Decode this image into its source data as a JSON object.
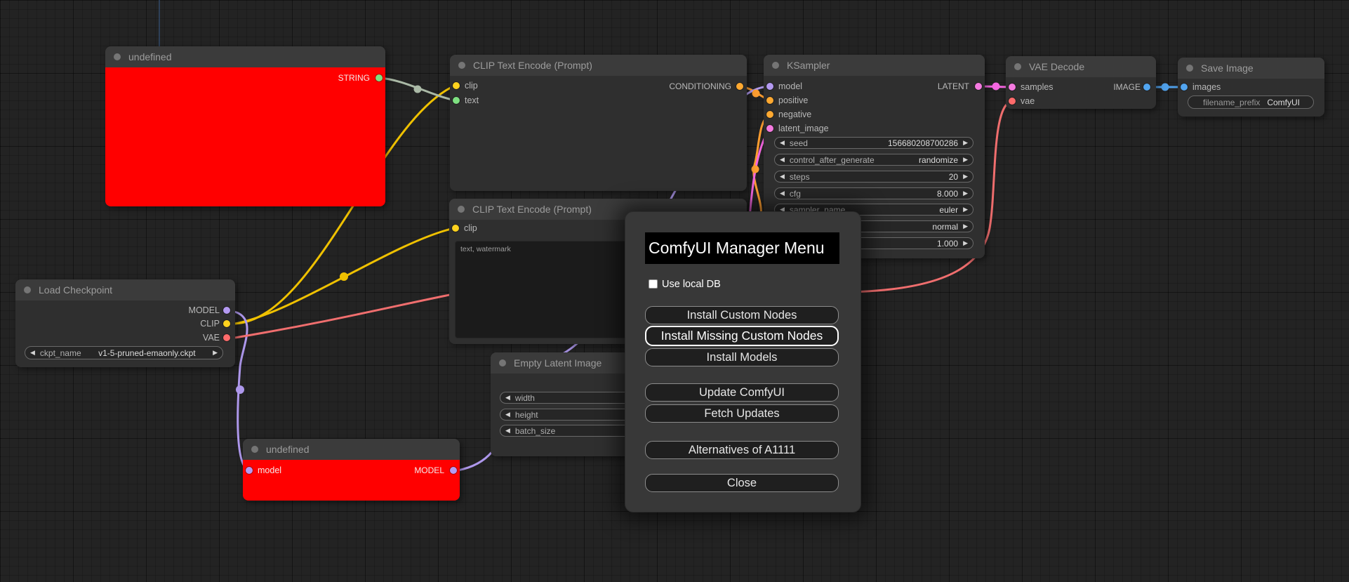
{
  "icons": {
    "left_arrow": "◀",
    "right_arrow": "▶"
  },
  "colors": {
    "canvas_bg": "#232323",
    "node_body": "#2f2f2f",
    "node_title_bar": "#3b3b3b",
    "error_node_body": "#ff0000",
    "slot_model": "#b49af2",
    "slot_clip": "#ffd21e",
    "slot_vae": "#ff6b6b",
    "slot_conditioning": "#ffa931",
    "slot_latent": "#f57ae0",
    "slot_image": "#52a5f0",
    "slot_string": "#7ee081",
    "wire_string": "#aab9a6"
  },
  "nodes": {
    "undefined_top": {
      "title": "undefined",
      "output_label": "STRING"
    },
    "clip_text_encode_1": {
      "title": "CLIP Text Encode (Prompt)",
      "input_clip": "clip",
      "input_text": "text",
      "output_label": "CONDITIONING"
    },
    "clip_text_encode_2": {
      "title": "CLIP Text Encode (Prompt)",
      "input_clip": "clip",
      "text_value": "text, watermark"
    },
    "ksampler": {
      "title": "KSampler",
      "inputs": {
        "model": "model",
        "positive": "positive",
        "negative": "negative",
        "latent_image": "latent_image"
      },
      "output_label": "LATENT",
      "widgets": [
        {
          "label": "seed",
          "value": "156680208700286"
        },
        {
          "label": "control_after_generate",
          "value": "randomize"
        },
        {
          "label": "steps",
          "value": "20"
        },
        {
          "label": "cfg",
          "value": "8.000"
        },
        {
          "label": "sampler_name",
          "value": "euler"
        },
        {
          "label": "",
          "value": "normal"
        },
        {
          "label": "",
          "value": "1.000"
        }
      ]
    },
    "vae_decode": {
      "title": "VAE Decode",
      "input_samples": "samples",
      "input_vae": "vae",
      "output_label": "IMAGE"
    },
    "save_image": {
      "title": "Save Image",
      "input_images": "images",
      "widget": {
        "label": "filename_prefix",
        "value": "ComfyUI"
      }
    },
    "load_checkpoint": {
      "title": "Load Checkpoint",
      "outputs": {
        "model": "MODEL",
        "clip": "CLIP",
        "vae": "VAE"
      },
      "widget": {
        "label": "ckpt_name",
        "value": "v1-5-pruned-emaonly.ckpt"
      }
    },
    "empty_latent_image": {
      "title": "Empty Latent Image",
      "widgets": [
        {
          "label": "width"
        },
        {
          "label": "height"
        },
        {
          "label": "batch_size"
        }
      ]
    },
    "undefined_bottom": {
      "title": "undefined",
      "input_label": "model",
      "output_label": "MODEL"
    }
  },
  "manager_menu": {
    "title": "ComfyUI Manager Menu",
    "use_local_db_label": "Use local DB",
    "use_local_db_checked": false,
    "buttons": {
      "install_custom_nodes": "Install Custom Nodes",
      "install_missing_custom_nodes": "Install Missing Custom Nodes",
      "install_models": "Install Models",
      "update_comfyui": "Update ComfyUI",
      "fetch_updates": "Fetch Updates",
      "alternatives_of_a1111": "Alternatives of A1111",
      "close": "Close"
    }
  }
}
